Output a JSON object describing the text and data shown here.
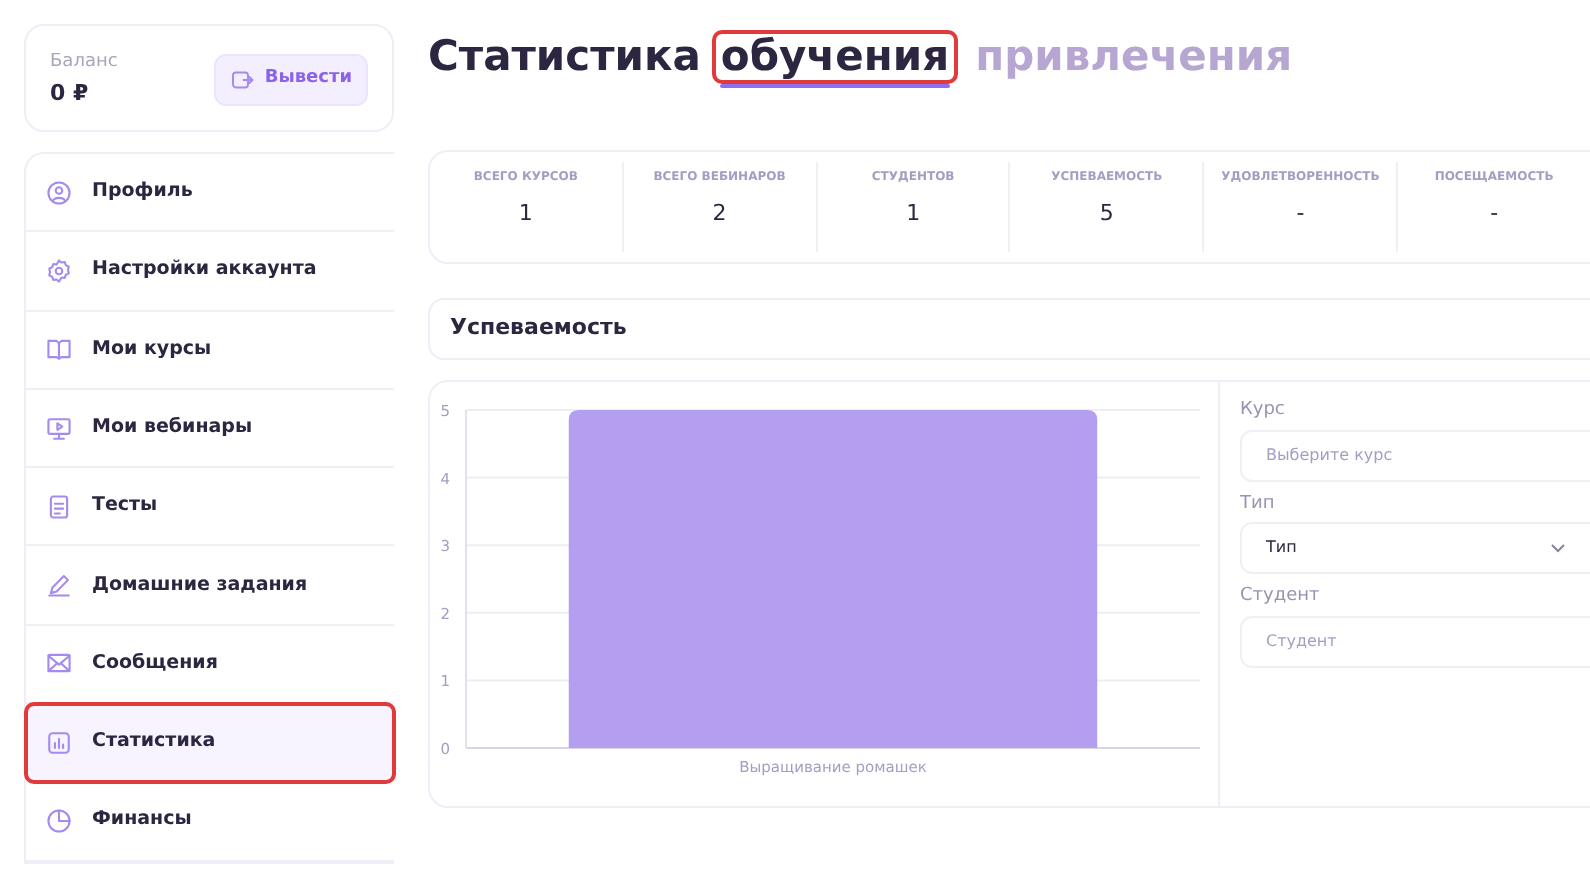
{
  "balance": {
    "label": "Баланс",
    "amount": "0 ₽",
    "withdraw_button": "Вывести"
  },
  "sidebar": {
    "items": [
      {
        "label": "Профиль",
        "selected": false,
        "highlighted": false
      },
      {
        "label": "Настройки аккаунта",
        "selected": false,
        "highlighted": false
      },
      {
        "label": "Мои курсы",
        "selected": false,
        "highlighted": false
      },
      {
        "label": "Мои вебинары",
        "selected": false,
        "highlighted": false
      },
      {
        "label": "Тесты",
        "selected": false,
        "highlighted": false
      },
      {
        "label": "Домашние задания",
        "selected": false,
        "highlighted": false
      },
      {
        "label": "Сообщения",
        "selected": false,
        "highlighted": false
      },
      {
        "label": "Статистика",
        "selected": true,
        "highlighted": true
      },
      {
        "label": "Финансы",
        "selected": false,
        "highlighted": false
      }
    ]
  },
  "heading": {
    "title": "Статистика",
    "tabs": [
      {
        "label": "обучения",
        "selected": true,
        "highlighted": true
      },
      {
        "label": "привлечения",
        "selected": false,
        "highlighted": false
      }
    ]
  },
  "stats": [
    {
      "label": "ВСЕГО КУРСОВ",
      "value": "1"
    },
    {
      "label": "ВСЕГО ВЕБИНАРОВ",
      "value": "2"
    },
    {
      "label": "СТУДЕНТОВ",
      "value": "1"
    },
    {
      "label": "УСПЕВАЕМОСТЬ",
      "value": "5"
    },
    {
      "label": "УДОВЛЕТВОРЕННОСТЬ",
      "value": "-"
    },
    {
      "label": "ПОСЕЩАЕМОСТЬ",
      "value": "-"
    }
  ],
  "section_title": "Успеваемость",
  "chart_data": {
    "type": "bar",
    "categories": [
      "Выращивание ромашек"
    ],
    "series": [
      {
        "color": "#b39ef0",
        "values": [
          5
        ]
      }
    ],
    "ylim": [
      0,
      5
    ],
    "yticks": [
      0,
      1,
      2,
      3,
      4,
      5
    ],
    "grid": true
  },
  "filters": [
    {
      "kind": "input",
      "label": "Курс",
      "placeholder": "Выберите курс"
    },
    {
      "kind": "select",
      "label": "Тип",
      "value": "Тип"
    },
    {
      "kind": "input",
      "label": "Студент",
      "placeholder": "Студент"
    }
  ]
}
